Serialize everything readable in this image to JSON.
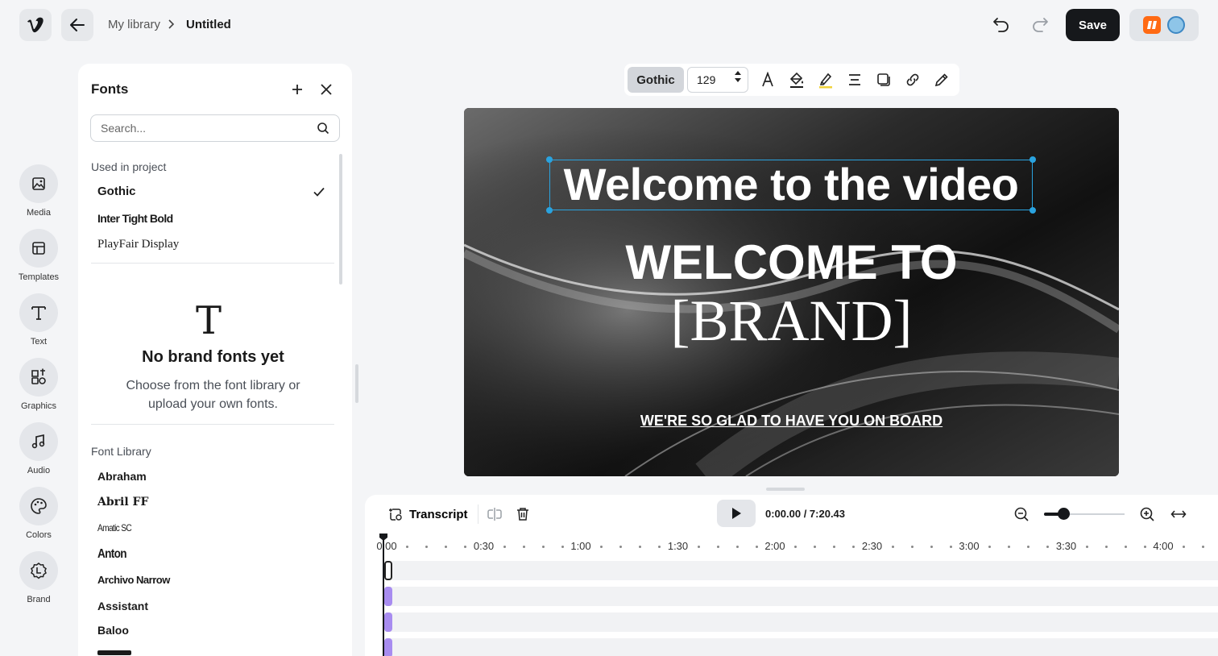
{
  "header": {
    "logo_icon": "vimeo-logo-icon",
    "breadcrumb": {
      "parent": "My library",
      "current": "Untitled"
    },
    "save_label": "Save"
  },
  "rail": [
    {
      "label": "Media",
      "icon": "image-icon"
    },
    {
      "label": "Templates",
      "icon": "layout-icon"
    },
    {
      "label": "Text",
      "icon": "text-icon"
    },
    {
      "label": "Graphics",
      "icon": "shapes-icon"
    },
    {
      "label": "Audio",
      "icon": "music-note-icon"
    },
    {
      "label": "Colors",
      "icon": "palette-icon"
    },
    {
      "label": "Brand",
      "icon": "brand-seal-icon"
    }
  ],
  "fonts_panel": {
    "title": "Fonts",
    "search_placeholder": "Search...",
    "used_label": "Used in project",
    "used_fonts": [
      "Gothic",
      "Inter Tight Bold",
      "PlayFair Display"
    ],
    "selected_font": "Gothic",
    "empty_title": "No brand fonts yet",
    "empty_desc": "Choose from the font library or upload your own fonts.",
    "library_label": "Font Library",
    "library_fonts": [
      "Abraham",
      "Abril FF",
      "Amatic SC",
      "Anton",
      "Archivo Narrow",
      "Assistant",
      "Baloo"
    ]
  },
  "toolbar": {
    "font": "Gothic",
    "size": "129"
  },
  "canvas": {
    "headline": "Welcome to the video",
    "line2": "WELCOME TO",
    "line3": "[BRAND]",
    "tagline": "WE'RE SO GLAD TO HAVE YOU ON BOARD"
  },
  "timeline": {
    "transcript_label": "Transcript",
    "timecode": "0:00.00 / 7:20.43",
    "zoom_level": 0.24,
    "ruler_ticks": [
      "0:00",
      "0:30",
      "1:00",
      "1:30",
      "2:00",
      "2:30",
      "3:00",
      "3:30",
      "4:00"
    ]
  }
}
